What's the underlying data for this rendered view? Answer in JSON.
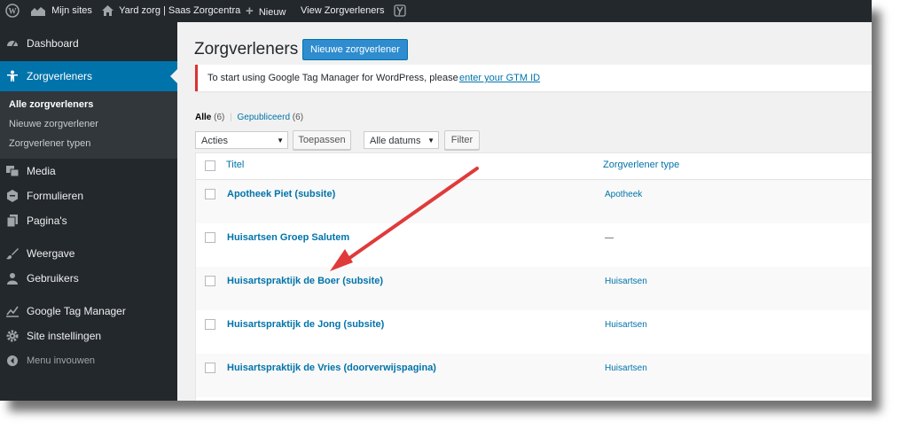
{
  "admin_bar": {
    "my_sites": "Mijn sites",
    "site_name": "Yard zorg | Saas Zorgcentra",
    "new": "Nieuw",
    "view": "View Zorgverleners"
  },
  "sidebar": {
    "items": [
      {
        "label": "Dashboard",
        "icon": "dashboard-icon"
      },
      {
        "label": "Zorgverleners",
        "icon": "person-icon"
      },
      {
        "label": "Media",
        "icon": "media-icon"
      },
      {
        "label": "Formulieren",
        "icon": "forms-icon"
      },
      {
        "label": "Pagina's",
        "icon": "pages-icon"
      },
      {
        "label": "Weergave",
        "icon": "brush-icon"
      },
      {
        "label": "Gebruikers",
        "icon": "users-icon"
      },
      {
        "label": "Google Tag Manager",
        "icon": "chart-icon"
      },
      {
        "label": "Site instellingen",
        "icon": "gear-icon"
      },
      {
        "label": "Menu invouwen",
        "icon": "collapse-icon"
      }
    ],
    "submenu": [
      "Alle zorgverleners",
      "Nieuwe zorgverlener",
      "Zorgverlener typen"
    ]
  },
  "main": {
    "title": "Zorgverleners",
    "new_button": "Nieuwe zorgverlener",
    "notice_text": "To start using Google Tag Manager for WordPress, please",
    "notice_link": "enter your GTM ID",
    "filters": {
      "all": "Alle",
      "all_count": "(6)",
      "separator": "|",
      "published": "Gepubliceerd",
      "published_count": "(6)"
    },
    "bulk_actions": "Acties",
    "apply": "Toepassen",
    "dates": "Alle datums",
    "filter": "Filter"
  },
  "table": {
    "columns": [
      "Titel",
      "Zorgverlener type"
    ],
    "rows": [
      {
        "title": "Apotheek Piet (subsite)",
        "type": "Apotheek"
      },
      {
        "title": "Huisartsen Groep Salutem",
        "type": "—"
      },
      {
        "title": "Huisartspraktijk de Boer (subsite)",
        "type": "Huisartsen"
      },
      {
        "title": "Huisartspraktijk de Jong (subsite)",
        "type": "Huisartsen"
      },
      {
        "title": "Huisartspraktijk de Vries (doorverwijspagina)",
        "type": "Huisartsen"
      }
    ]
  },
  "colors": {
    "admin_bg": "#23282d",
    "accent": "#0073aa",
    "notice_border": "#dc3232",
    "annotation_arrow": "#e03a3a"
  }
}
